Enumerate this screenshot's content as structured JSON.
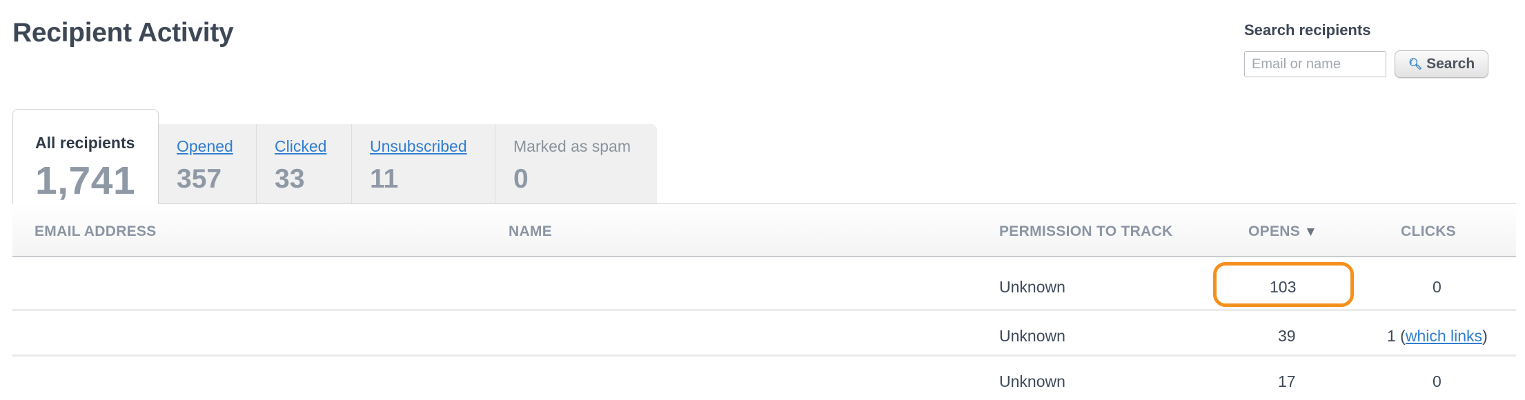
{
  "page": {
    "title": "Recipient Activity"
  },
  "search": {
    "label": "Search recipients",
    "placeholder": "Email or name",
    "button_label": "Search",
    "button_icon": "magnifier-icon"
  },
  "tabs": {
    "active": {
      "label": "All recipients",
      "count": "1,741"
    },
    "items": [
      {
        "label": "Opened",
        "count": "357",
        "link": true
      },
      {
        "label": "Clicked",
        "count": "33",
        "link": true
      },
      {
        "label": "Unsubscribed",
        "count": "11",
        "link": true
      },
      {
        "label": "Marked as spam",
        "count": "0",
        "link": false
      }
    ]
  },
  "table": {
    "columns": {
      "email": "EMAIL ADDRESS",
      "name": "NAME",
      "permission": "PERMISSION TO TRACK",
      "opens": "OPENS",
      "opens_sort": "▼",
      "clicks": "CLICKS"
    },
    "rows": [
      {
        "email": "",
        "name": "",
        "permission": "Unknown",
        "opens": "103",
        "clicks": "0",
        "clicks_link": ""
      },
      {
        "email": "",
        "name": "",
        "permission": "Unknown",
        "opens": "39",
        "clicks": "1 (",
        "clicks_link": "which links",
        "clicks_suffix": ")"
      },
      {
        "email": "",
        "name": "",
        "permission": "Unknown",
        "opens": "17",
        "clicks": "0",
        "clicks_link": ""
      }
    ]
  },
  "colors": {
    "accent": "#2f7dd1",
    "highlight": "#f5901e"
  }
}
